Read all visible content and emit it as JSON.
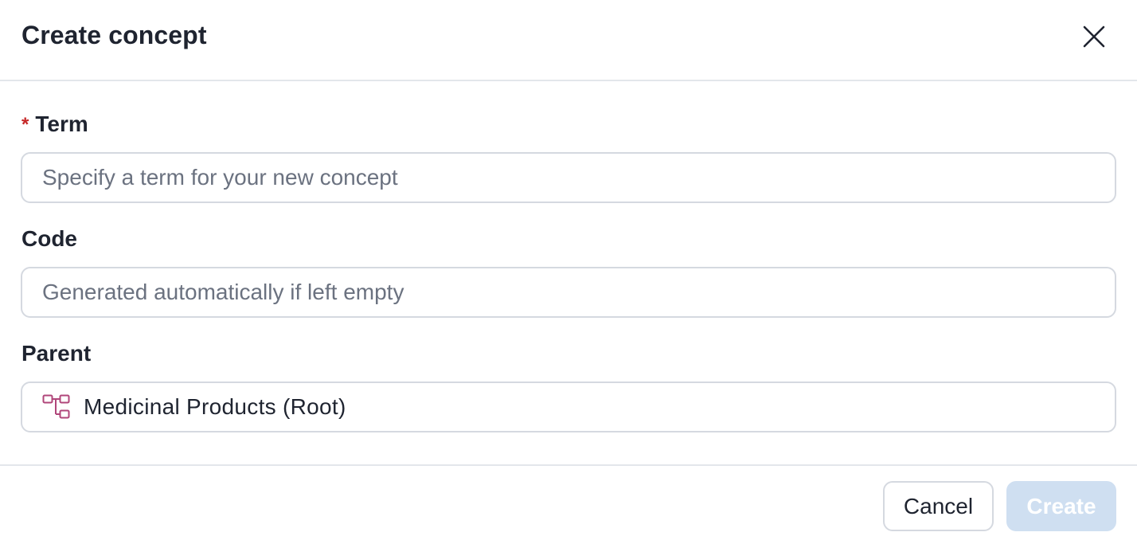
{
  "dialog": {
    "title": "Create concept",
    "close_icon": "close-icon"
  },
  "fields": {
    "term": {
      "required_marker": "*",
      "label": "Term",
      "value": "",
      "placeholder": "Specify a term for your new concept"
    },
    "code": {
      "label": "Code",
      "value": "",
      "placeholder": "Generated automatically if left empty"
    },
    "parent": {
      "label": "Parent",
      "icon": "hierarchy-tree-icon",
      "value": "Medicinal Products (Root)"
    }
  },
  "footer": {
    "cancel_label": "Cancel",
    "create_label": "Create",
    "create_disabled": true
  },
  "colors": {
    "required": "#c62828",
    "tree_icon": "#b0467a",
    "create_disabled_bg": "#cfdff1",
    "border": "#d5d9e0"
  }
}
